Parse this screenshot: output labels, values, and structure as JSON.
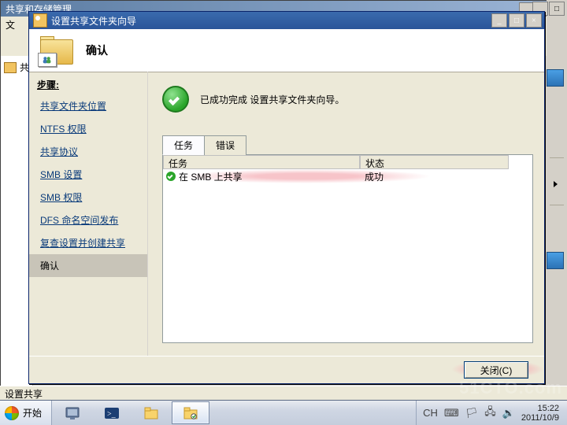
{
  "bg_window": {
    "title": "共享和存储管理",
    "menu_file": "文"
  },
  "bg_left_label": "共",
  "status_bar": "设置共享",
  "wizard": {
    "title": "设置共享文件夹向导",
    "header_title": "确认",
    "steps_label": "步骤:",
    "steps": [
      "共享文件夹位置",
      "NTFS 权限",
      "共享协议",
      "SMB 设置",
      "SMB 权限",
      "DFS 命名空间发布",
      "复查设置并创建共享",
      "确认"
    ],
    "success_msg": "已成功完成 设置共享文件夹向导。",
    "tabs": {
      "tasks": "任务",
      "errors": "错误"
    },
    "list_headers": {
      "task": "任务",
      "status": "状态"
    },
    "list_row": {
      "task": "在 SMB 上共享",
      "status": "成功"
    },
    "close_btn": "关闭(C)"
  },
  "taskbar": {
    "start": "开始",
    "lang": "CH",
    "time": "15:22",
    "date": "2011/10/9"
  },
  "watermark": "51CTO.com"
}
